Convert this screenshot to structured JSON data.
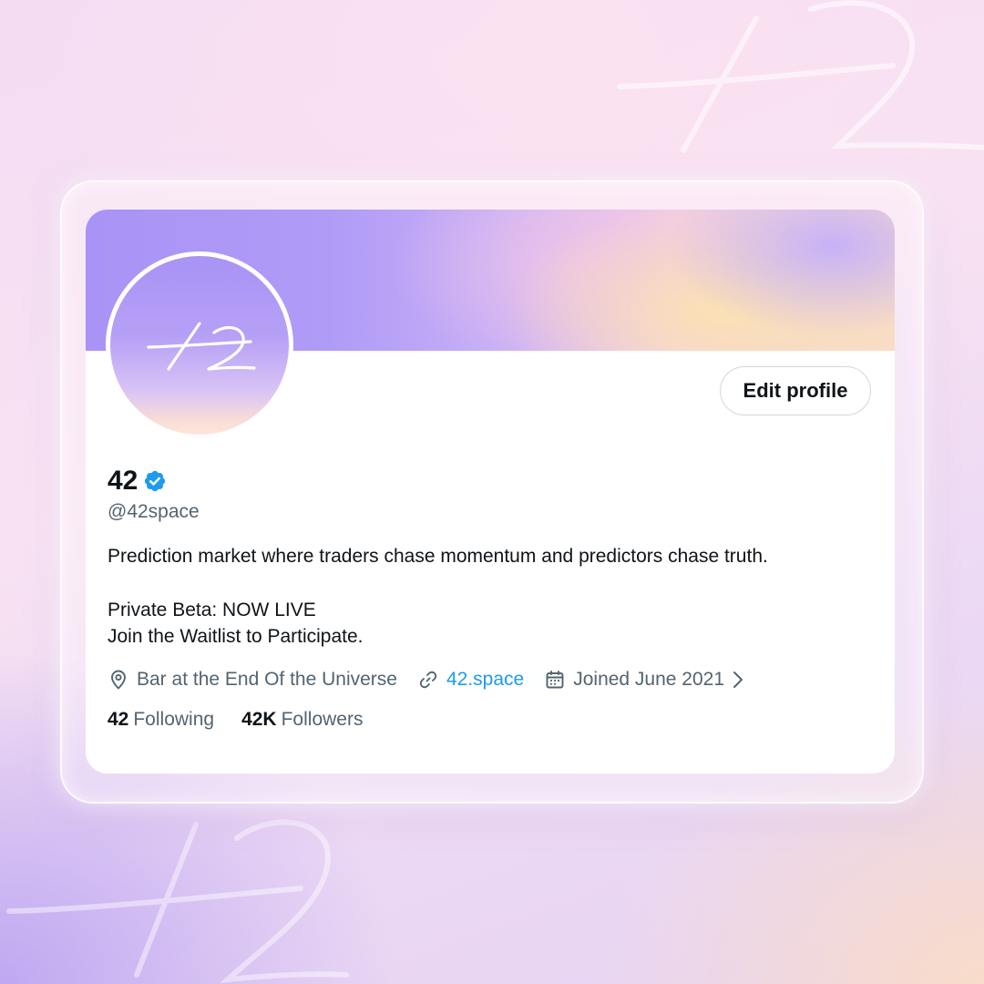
{
  "profile": {
    "display_name": "42",
    "handle": "@42space",
    "bio_line1": "Prediction market where traders chase momentum and predictors chase truth.",
    "bio_line2": "Private Beta: NOW LIVE",
    "bio_line3": "Join the Waitlist to Participate.",
    "location": "Bar at the End Of the Universe",
    "website": "42.space",
    "joined": "Joined June 2021",
    "following_count": "42",
    "following_label": "Following",
    "followers_count": "42K",
    "followers_label": "Followers"
  },
  "actions": {
    "edit_profile_label": "Edit profile"
  },
  "icons": {
    "verified": "verified-badge-icon",
    "location": "map-pin-icon",
    "website": "link-icon",
    "joined": "calendar-icon",
    "expand": "chevron-right-icon"
  },
  "colors": {
    "accent": "#1d9bf0",
    "text_primary": "#0f1419",
    "text_secondary": "#536471",
    "banner_purple": "#a993f6",
    "banner_peach": "#f8dcc8"
  }
}
